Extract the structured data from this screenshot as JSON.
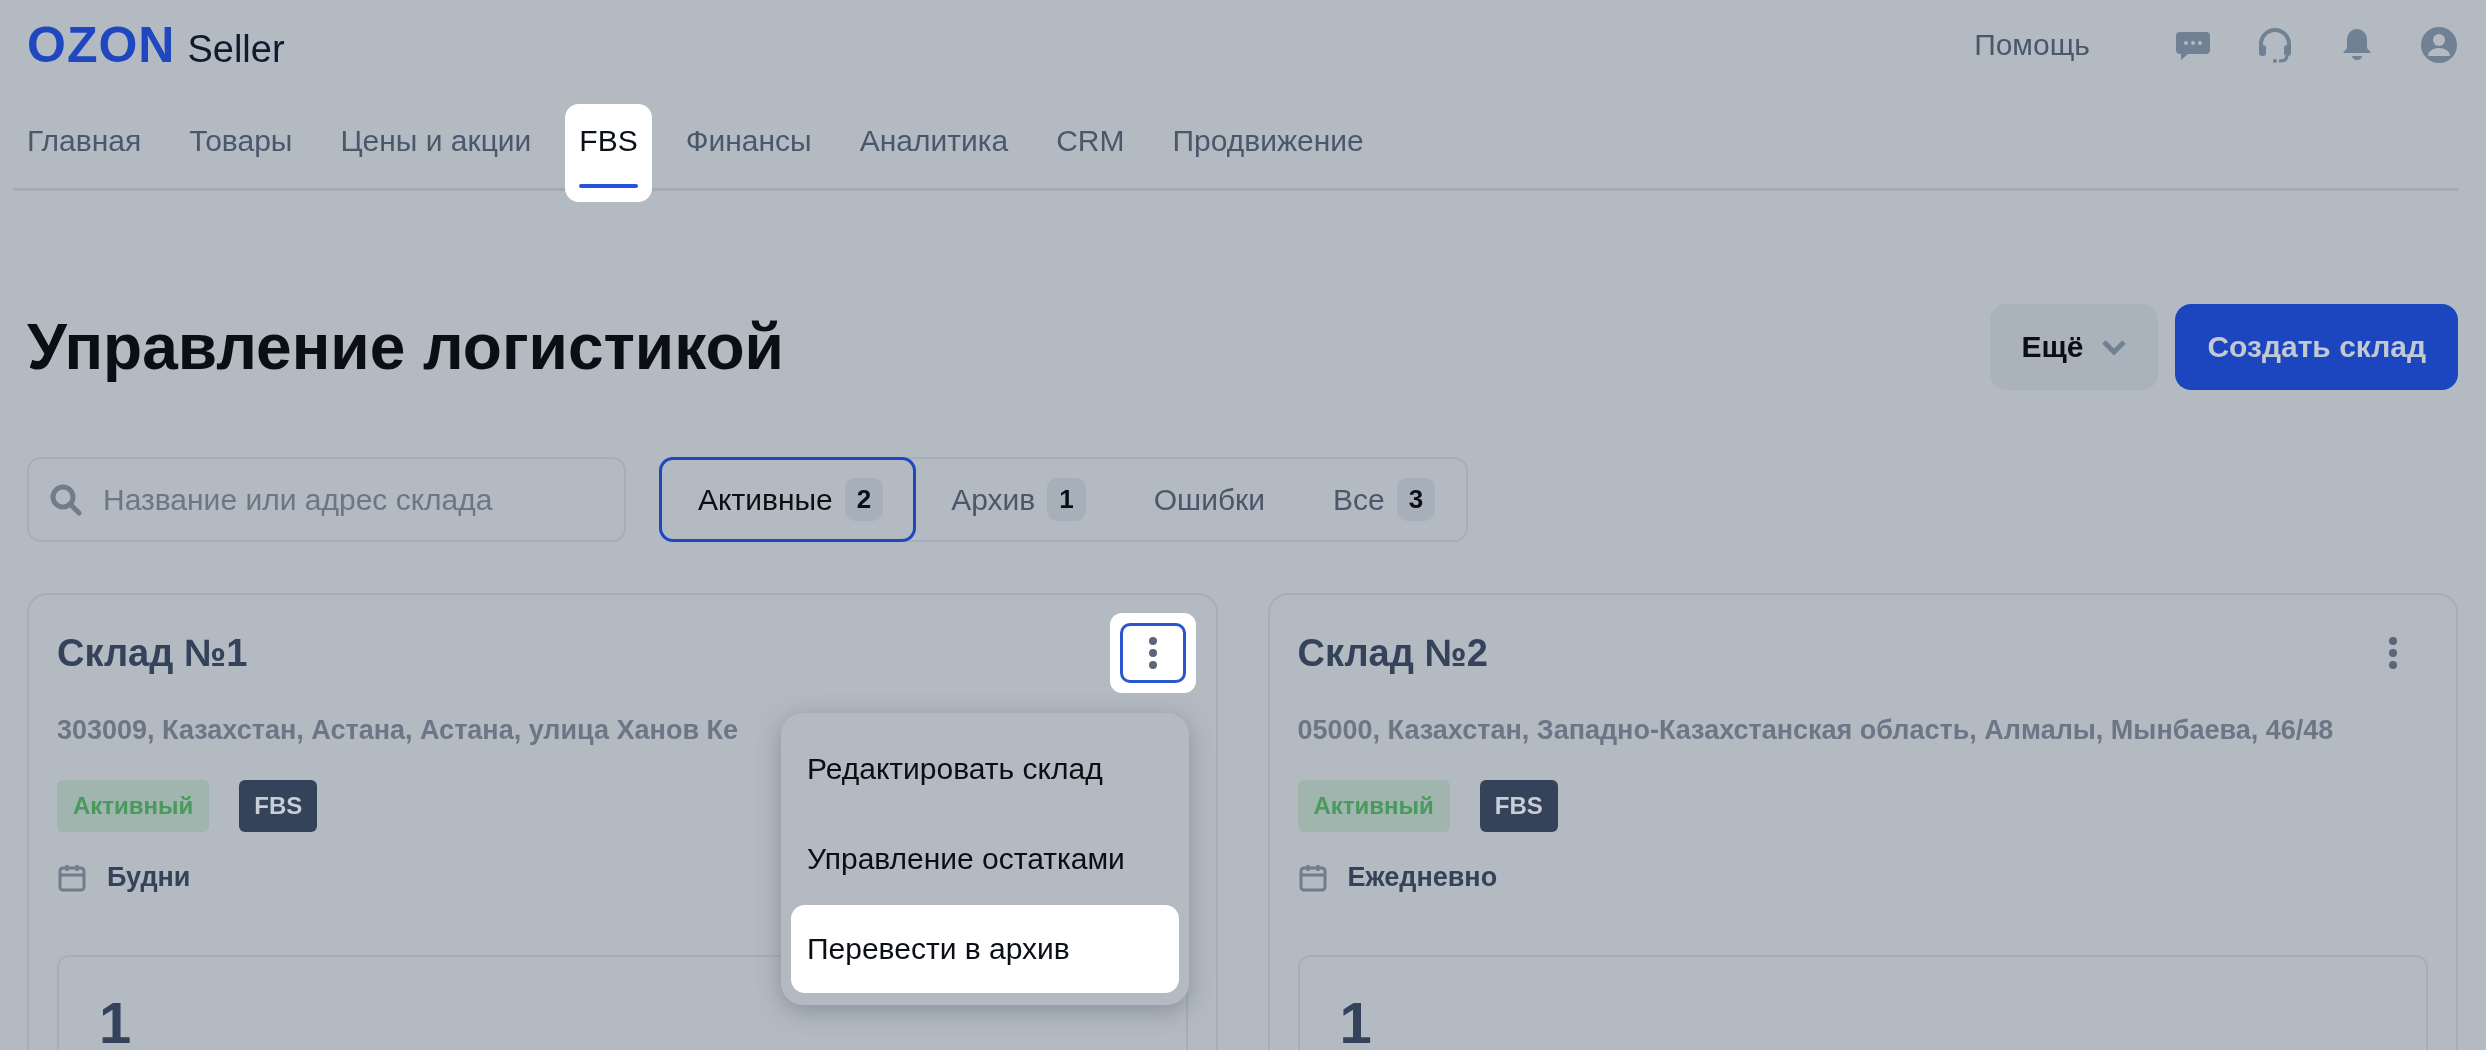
{
  "header": {
    "logo": "OZON",
    "logo_suffix": "Seller",
    "help": "Помощь"
  },
  "nav": [
    {
      "label": "Главная",
      "selected": false
    },
    {
      "label": "Товары",
      "selected": false
    },
    {
      "label": "Цены и акции",
      "selected": false
    },
    {
      "label": "FBS",
      "selected": true
    },
    {
      "label": "Финансы",
      "selected": false
    },
    {
      "label": "Аналитика",
      "selected": false
    },
    {
      "label": "CRM",
      "selected": false
    },
    {
      "label": "Продвижение",
      "selected": false
    }
  ],
  "page_title": "Управление логистикой",
  "actions": {
    "more": "Ещё",
    "create": "Создать склад"
  },
  "search": {
    "placeholder": "Название или адрес склада"
  },
  "filters": [
    {
      "label": "Активные",
      "count": "2",
      "selected": true
    },
    {
      "label": "Архив",
      "count": "1",
      "selected": false
    },
    {
      "label": "Ошибки",
      "selected": false
    },
    {
      "label": "Все",
      "count": "3",
      "selected": false
    }
  ],
  "warehouses": [
    {
      "name": "Склад №1",
      "address": "303009, Казахстан, Астана, Астана, улица Ханов Ке",
      "status": "Активный",
      "type": "FBS",
      "schedule": "Будни",
      "stock": "1",
      "menu_open": true
    },
    {
      "name": "Склад №2",
      "address": "05000, Казахстан, Западно-Казахстанская область, Алмалы, Мынбаева, 46/48",
      "status": "Активный",
      "type": "FBS",
      "schedule": "Ежедневно",
      "stock": "1",
      "menu_open": false
    }
  ],
  "menu": {
    "items": [
      {
        "label": "Редактировать склад",
        "highlighted": false
      },
      {
        "label": "Управление остатками",
        "highlighted": false
      },
      {
        "label": "Перевести в архив",
        "highlighted": true
      }
    ]
  }
}
